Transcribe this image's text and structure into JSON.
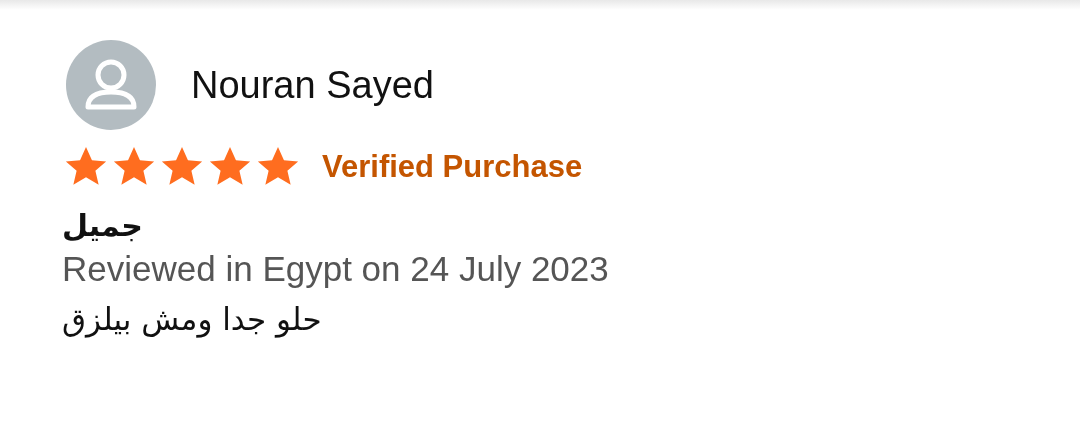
{
  "review": {
    "author": "Nouran Sayed",
    "stars": 5,
    "badge": "Verified Purchase",
    "title": "جميل",
    "meta": "Reviewed in Egypt on 24 July 2023",
    "body": "حلو جدا ومش بيلزق"
  }
}
